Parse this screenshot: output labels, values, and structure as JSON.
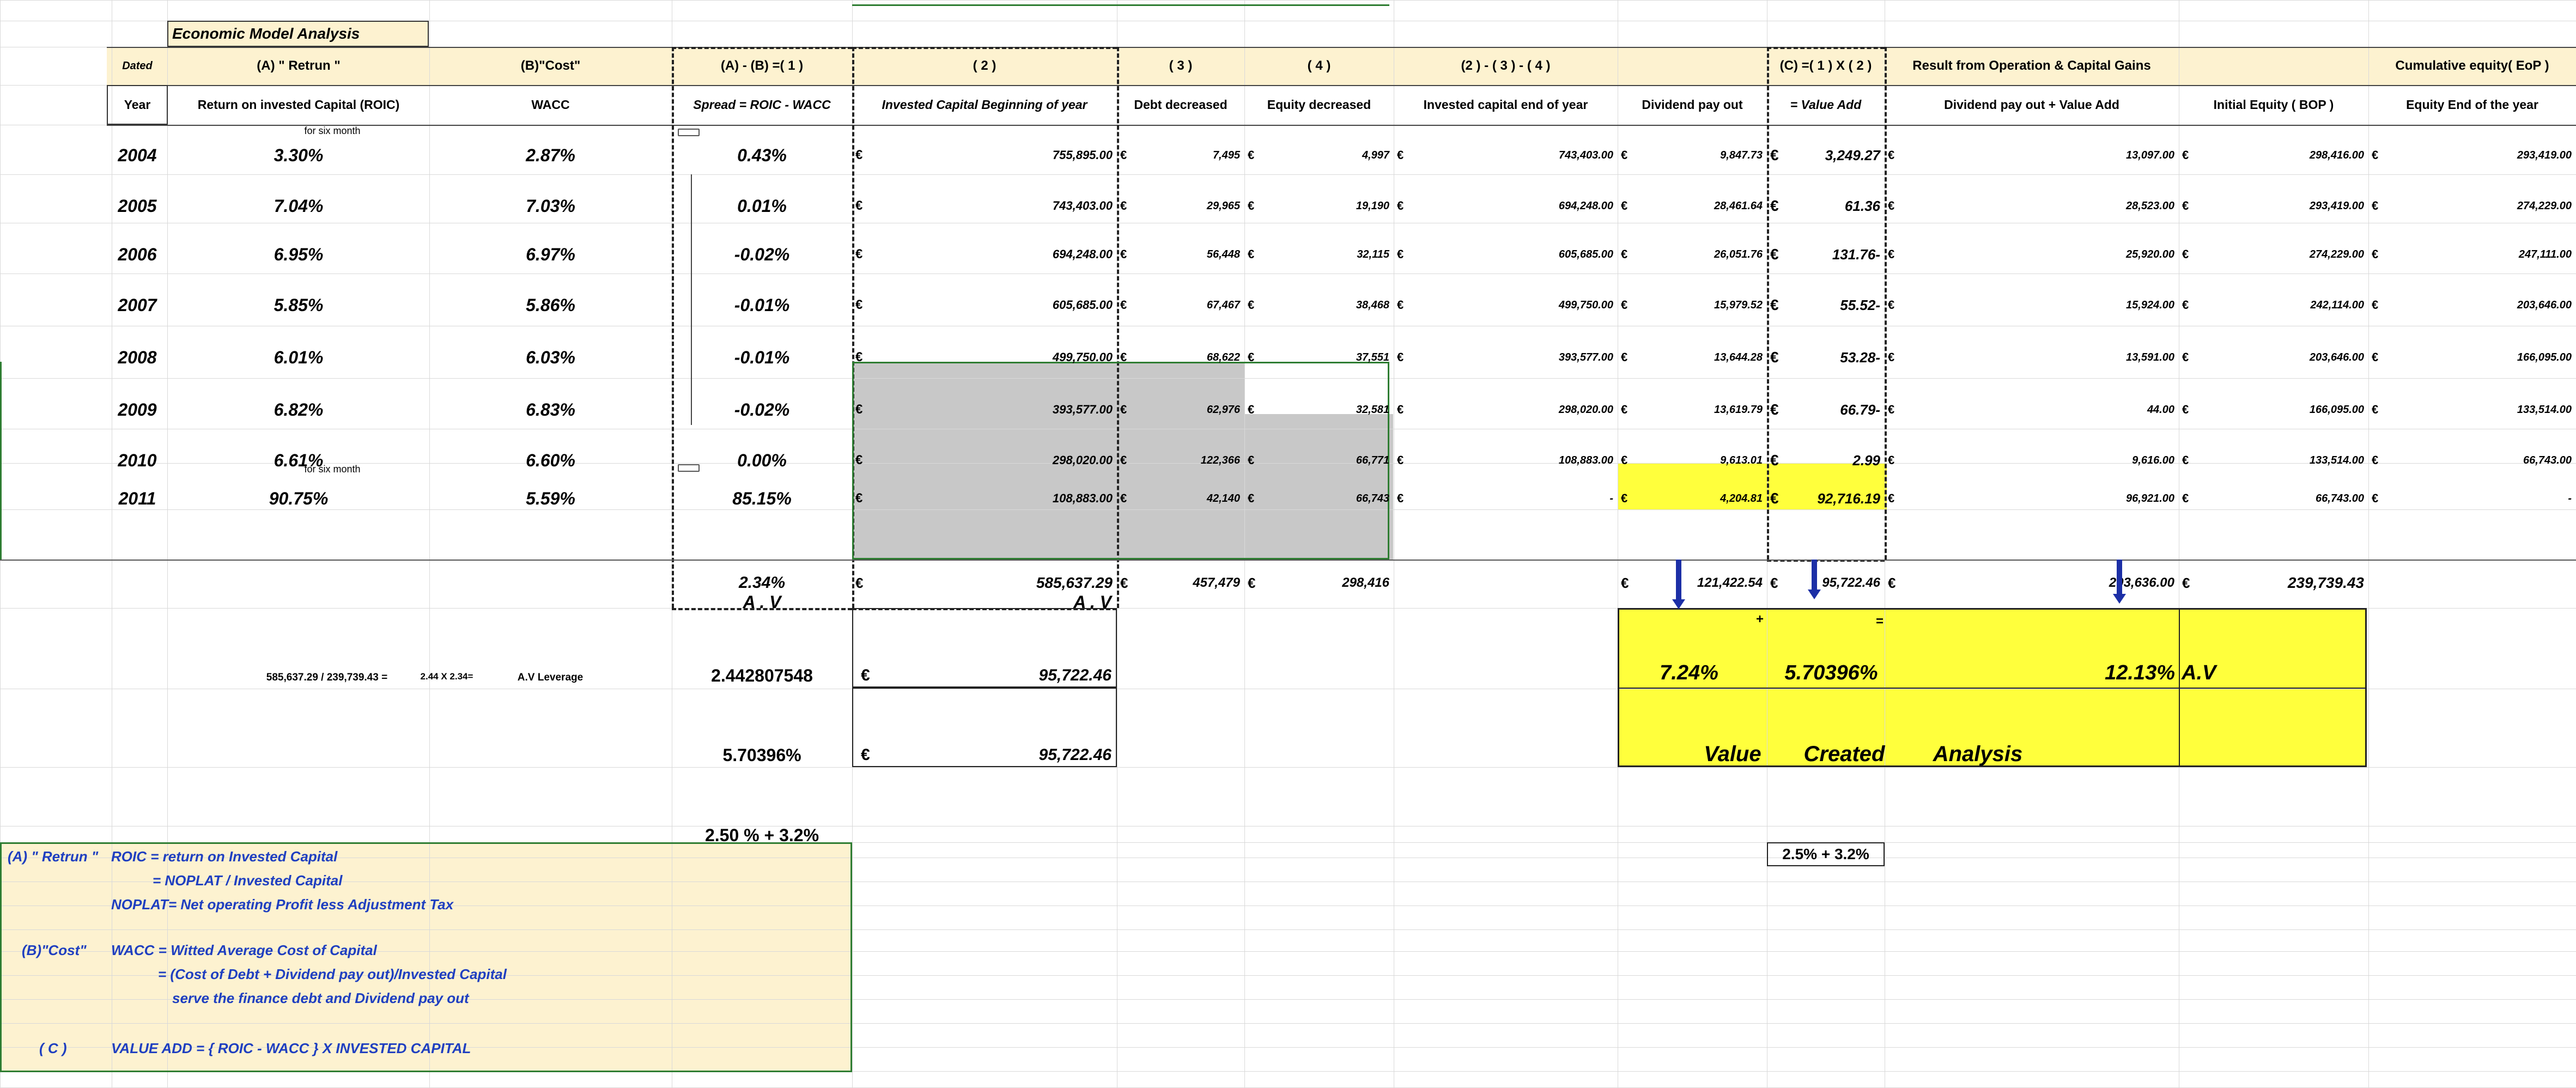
{
  "sheet": {
    "title": "Economic Model Analysis",
    "colors": {
      "header_fill": "#fdf2d0",
      "yellow": "#ffff3c",
      "gray_fill": "#c8c8c8",
      "grid": "#d9d9d9",
      "blue_text": "#1f3fc0",
      "arrow": "#1c2fa6",
      "selection_green": "#2e7d32"
    },
    "group_headers": [
      "Dated",
      "(A) \" Retrun \"",
      "(B)\"Cost\"",
      "(A) - (B) =( 1 )",
      "( 2 )",
      "( 3 )",
      "( 4 )",
      "(2 ) - ( 3 ) - ( 4 )",
      "(C) =( 1 ) X ( 2 )",
      "Result from Operation & Capital Gains",
      "Cumulative equity( EoP )"
    ],
    "column_headers": [
      "Year",
      "Return on invested Capital (ROIC)",
      "WACC",
      "Spread = ROIC - WACC",
      "Invested Capital Beginning of year",
      "Debt decreased",
      "Equity decreased",
      "Invested capital end of year",
      "Dividend pay out",
      "= Value Add",
      "Dividend pay out + Value Add",
      "Initial Equity ( BOP )",
      "Equity End of the year"
    ],
    "notes": {
      "six_month_top": "for six month",
      "six_month_bottom": "for six month"
    },
    "currency_symbol": "€",
    "rows": [
      [
        "2004",
        "3.30%",
        "2.87%",
        "0.43%",
        "755,895.00",
        "7,495",
        "4,997",
        "743,403.00",
        "9,847.73",
        "3,249.27",
        "13,097.00",
        "298,416.00",
        "293,419.00"
      ],
      [
        "2005",
        "7.04%",
        "7.03%",
        "0.01%",
        "743,403.00",
        "29,965",
        "19,190",
        "694,248.00",
        "28,461.64",
        "61.36",
        "28,523.00",
        "293,419.00",
        "274,229.00"
      ],
      [
        "2006",
        "6.95%",
        "6.97%",
        "-0.02%",
        "694,248.00",
        "56,448",
        "32,115",
        "605,685.00",
        "26,051.76",
        "131.76-",
        "25,920.00",
        "274,229.00",
        "247,111.00"
      ],
      [
        "2007",
        "5.85%",
        "5.86%",
        "-0.01%",
        "605,685.00",
        "67,467",
        "38,468",
        "499,750.00",
        "15,979.52",
        "55.52-",
        "15,924.00",
        "242,114.00",
        "203,646.00"
      ],
      [
        "2008",
        "6.01%",
        "6.03%",
        "-0.01%",
        "499,750.00",
        "68,622",
        "37,551",
        "393,577.00",
        "13,644.28",
        "53.28-",
        "13,591.00",
        "203,646.00",
        "166,095.00"
      ],
      [
        "2009",
        "6.82%",
        "6.83%",
        "-0.02%",
        "393,577.00",
        "62,976",
        "32,581",
        "298,020.00",
        "13,619.79",
        "66.79-",
        "44.00",
        "166,095.00",
        "133,514.00"
      ],
      [
        "2010",
        "6.61%",
        "6.60%",
        "0.00%",
        "298,020.00",
        "122,366",
        "66,771",
        "108,883.00",
        "9,613.01",
        "2.99",
        "9,616.00",
        "133,514.00",
        "66,743.00"
      ],
      [
        "2011",
        "90.75%",
        "5.59%",
        "85.15%",
        "108,883.00",
        "42,140",
        "66,743",
        "-",
        "4,204.81",
        "92,716.19",
        "96,921.00",
        "66,743.00",
        "-"
      ]
    ],
    "totals": {
      "spread": "2.34%",
      "invested_capital": "585,637.29",
      "debt": "457,479",
      "equity": "298,416",
      "dividend": "121,422.54",
      "value_add": "95,722.46",
      "dividend_plus_value": "203,636.00",
      "initial_equity": "239,739.43"
    },
    "av_labels": {
      "spread": "A . V",
      "capital": "A . V"
    },
    "leverage": {
      "formula": "585,637.29 / 239,739.43 =",
      "product": "2.44 X 2.34=",
      "label": "A.V Leverage",
      "value": "2.442807548",
      "amount": "95,722.46",
      "pct": "5.70396%",
      "amount2": "95,722.46",
      "sum": "2.50 % + 3.2%"
    },
    "yellow_box": {
      "plus": "+",
      "equals": "=",
      "v1": "7.24%",
      "v2": "5.70396%",
      "v3": "12.13%",
      "av": "A.V",
      "caption": [
        "Value",
        "Created",
        "Analysis"
      ]
    },
    "small_box": "2.5% + 3.2%",
    "legend": {
      "l1a": "(A) \" Retrun \"",
      "l1b": "ROIC  =    return on Invested Capital",
      "l2": "=  NOPLAT / Invested Capital",
      "l3": "NOPLAT= Net operating  Profit less Adjustment Tax",
      "l4a": "(B)\"Cost\"",
      "l4b": "WACC = Witted Average Cost of Capital",
      "l5": "=  (Cost of Debt + Dividend pay out)/Invested Capital",
      "l6": "serve the finance  debt and Dividend pay out",
      "l7a": "( C )",
      "l7b": "VALUE ADD  =  { ROIC - WACC }   X   INVESTED CAPITAL"
    }
  }
}
